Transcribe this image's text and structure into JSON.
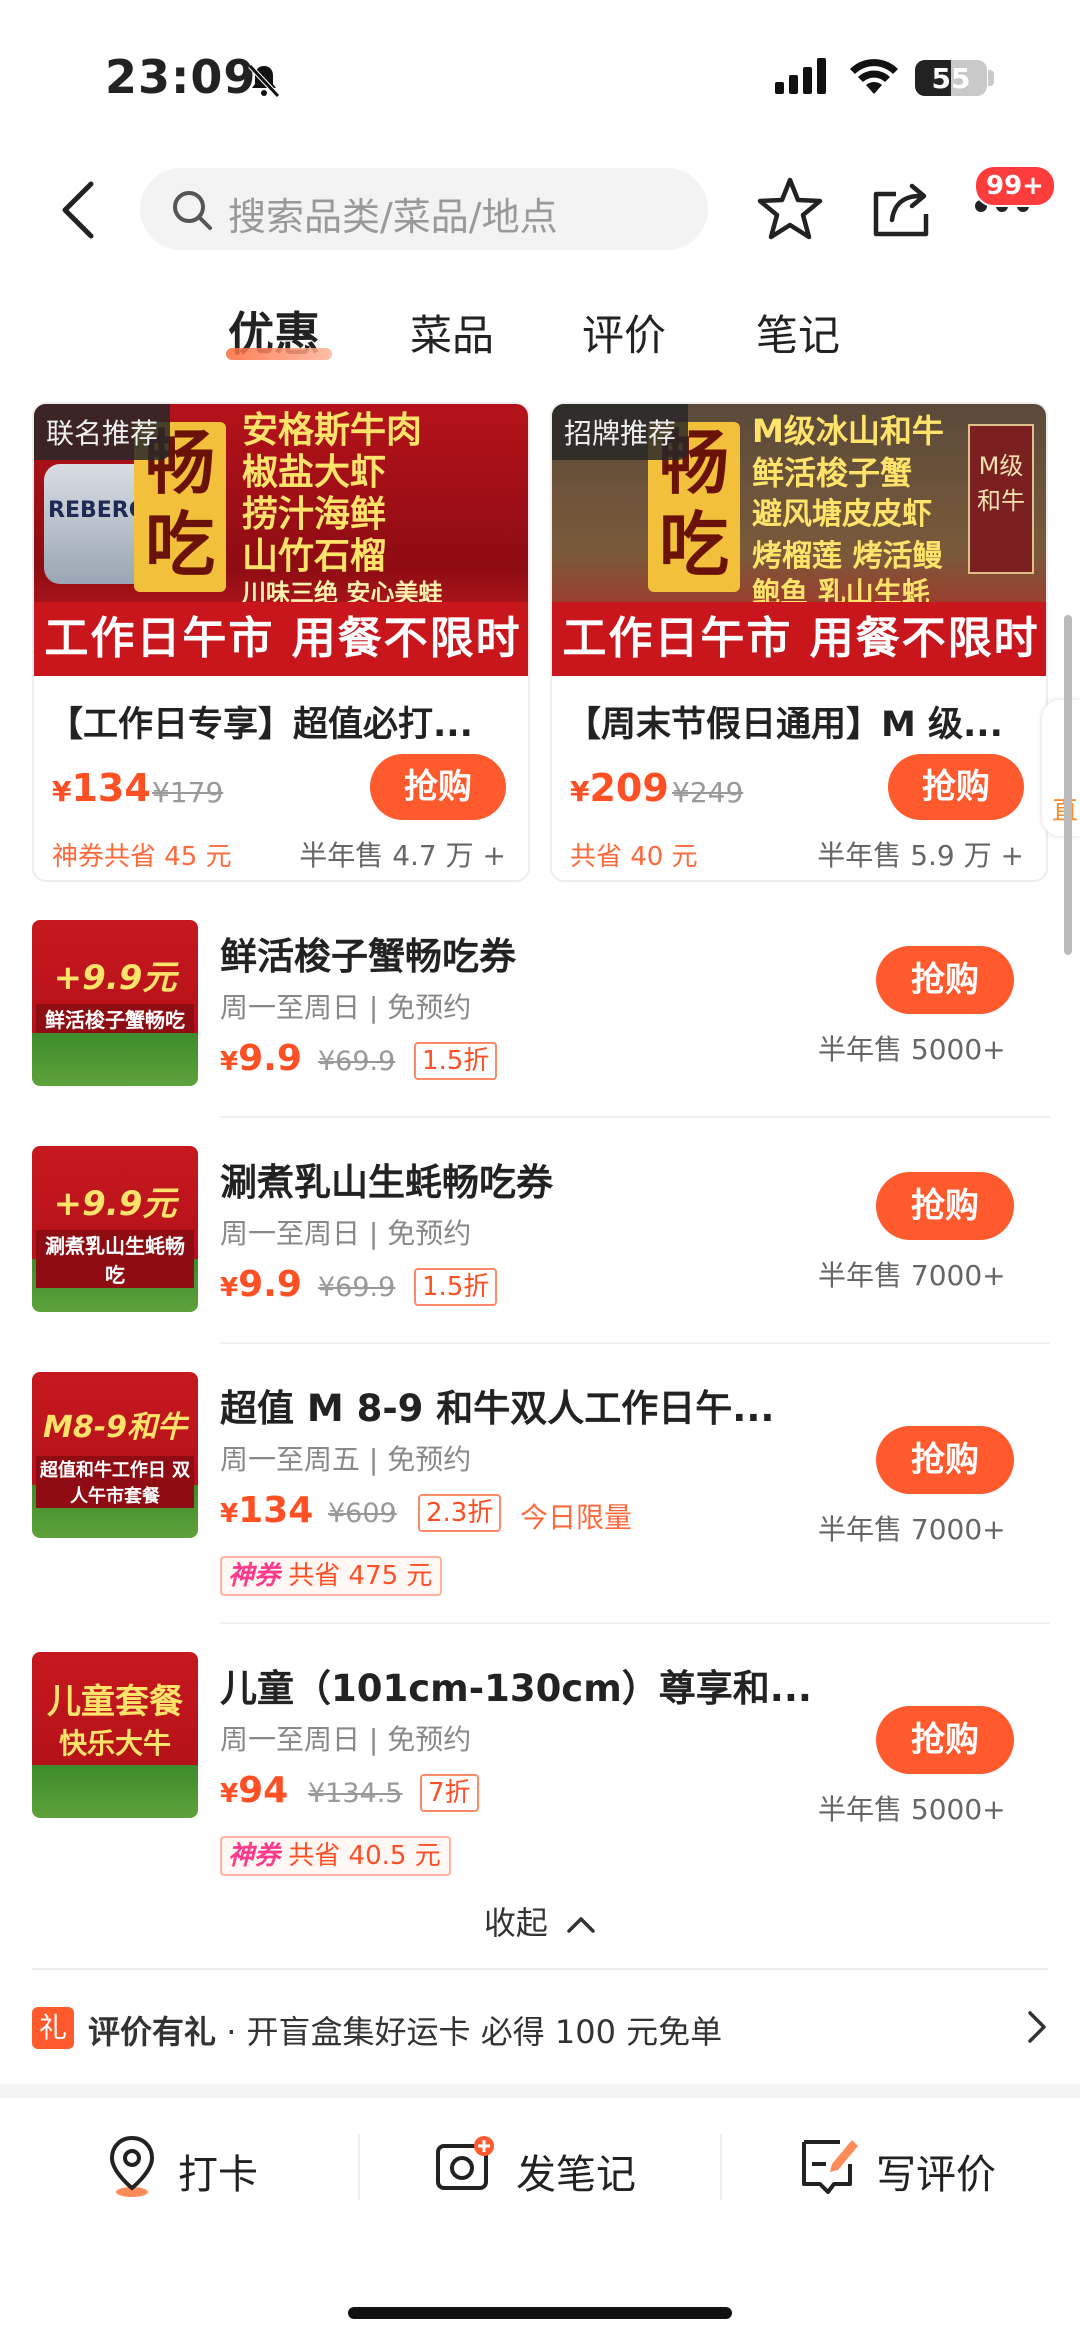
{
  "status": {
    "time": "23:09",
    "battery": "55"
  },
  "search": {
    "placeholder": "搜索品类/菜品/地点"
  },
  "badge": "99+",
  "tabs": [
    "优惠",
    "菜品",
    "评价",
    "笔记"
  ],
  "cards": [
    {
      "tag": "联名推荐",
      "big_char": "畅吃",
      "img_lines": [
        "安格斯牛肉",
        "椒盐大虾",
        "捞汁海鲜",
        "山竹石榴"
      ],
      "img_small": "川味三绝 安心美蛙",
      "can_text": "REBERG",
      "banner": "工作日午市 用餐不限时",
      "title": "【工作日专享】超值必打...",
      "price": "134",
      "orig": "¥179",
      "buy": "抢购",
      "save": "神券共省 45 元",
      "sold": "半年售 4.7 万 +"
    },
    {
      "tag": "招牌推荐",
      "big_char": "畅吃",
      "img_lines": [
        "M级冰山和牛",
        "鲜活梭子蟹",
        "避风塘皮皮虾",
        "烤榴莲 烤活鳗"
      ],
      "img_small": "鲍鱼 乳山生蚝",
      "banner": "工作日午市 用餐不限时",
      "title": "【周末节假日通用】M 级...",
      "price": "209",
      "orig": "¥249",
      "buy": "抢购",
      "save": "共省 40 元",
      "sold": "半年售 5.9 万 +"
    }
  ],
  "items": [
    {
      "thumb_big": "+9.9元",
      "thumb_small": "鲜活梭子蟹畅吃",
      "name": "鲜活梭子蟹畅吃券",
      "sub": "周一至周日 | 免预约",
      "price": "9.9",
      "orig": "¥69.9",
      "disc": "1.5折",
      "buy": "抢购",
      "sold": "半年售 5000+"
    },
    {
      "thumb_big": "+9.9元",
      "thumb_small": "涮煮乳山生蚝畅吃",
      "name": "涮煮乳山生蚝畅吃券",
      "sub": "周一至周日 | 免预约",
      "price": "9.9",
      "orig": "¥69.9",
      "disc": "1.5折",
      "buy": "抢购",
      "sold": "半年售 7000+"
    },
    {
      "thumb_big": "M8-9和牛",
      "thumb_small": "超值和牛工作日 双人午市套餐",
      "name": "超值 M 8-9 和牛双人工作日午...",
      "sub": "周一至周五 | 免预约",
      "price": "134",
      "orig": "¥609",
      "disc": "2.3折",
      "limit": "今日限量",
      "coupon_tag": "神券",
      "coupon": "共省 475 元",
      "buy": "抢购",
      "sold": "半年售 7000+"
    },
    {
      "thumb_big": "儿童套餐",
      "thumb_small": "快乐大牛",
      "name": "儿童（101cm-130cm）尊享和...",
      "sub": "周一至周日 | 免预约",
      "price": "94",
      "orig": "¥134.5",
      "disc": "7折",
      "coupon_tag": "神券",
      "coupon": "共省 40.5 元",
      "buy": "抢购",
      "sold": "半年售 5000+"
    }
  ],
  "collapse": "收起",
  "promo": {
    "icon": "礼",
    "bold": "评价有礼",
    "text": " · 开盲盒集好运卡 必得 100 元免单"
  },
  "bottom": {
    "checkin": "打卡",
    "note": "发笔记",
    "review": "写评价"
  },
  "edge_tab": "直",
  "colors": {
    "accent": "#ff5a2d",
    "price": "#ff4f24"
  }
}
